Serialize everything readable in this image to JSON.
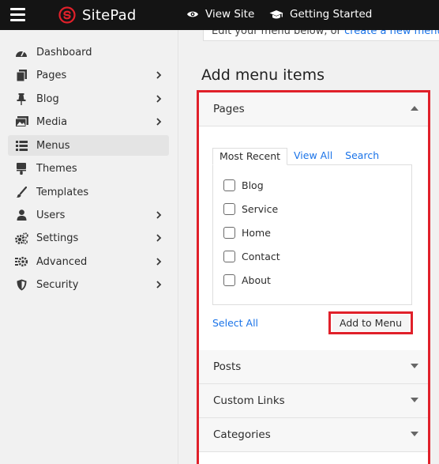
{
  "topbar": {
    "menu_icon": "hamburger-icon",
    "brand": "SitePad",
    "view_site": "View Site",
    "getting_started": "Getting Started",
    "brand_color": "#e0202a"
  },
  "sidebar": {
    "items": [
      {
        "label": "Dashboard",
        "icon": "dashboard-icon",
        "has_submenu": false
      },
      {
        "label": "Pages",
        "icon": "pages-icon",
        "has_submenu": true
      },
      {
        "label": "Blog",
        "icon": "pin-icon",
        "has_submenu": true
      },
      {
        "label": "Media",
        "icon": "media-icon",
        "has_submenu": true
      },
      {
        "label": "Menus",
        "icon": "menus-icon",
        "has_submenu": false,
        "active": true
      },
      {
        "label": "Themes",
        "icon": "themes-icon",
        "has_submenu": false
      },
      {
        "label": "Templates",
        "icon": "brush-icon",
        "has_submenu": false
      },
      {
        "label": "Users",
        "icon": "user-icon",
        "has_submenu": true
      },
      {
        "label": "Settings",
        "icon": "settings-icon",
        "has_submenu": true
      },
      {
        "label": "Advanced",
        "icon": "advanced-icon",
        "has_submenu": true
      },
      {
        "label": "Security",
        "icon": "shield-icon",
        "has_submenu": true
      }
    ]
  },
  "main": {
    "info_text": "Edit your menu below, or ",
    "info_link": "create a new menu.",
    "section_title": "Add menu items",
    "panels": {
      "pages": {
        "title": "Pages",
        "tabs": [
          "Most Recent",
          "View All",
          "Search"
        ],
        "items": [
          "Blog",
          "Service",
          "Home",
          "Contact",
          "About"
        ],
        "select_all": "Select All",
        "add_button": "Add to Menu"
      },
      "posts": {
        "title": "Posts"
      },
      "custom_links": {
        "title": "Custom Links"
      },
      "categories": {
        "title": "Categories"
      }
    },
    "highlight_color": "#e0202a",
    "link_color": "#1a73e8"
  }
}
